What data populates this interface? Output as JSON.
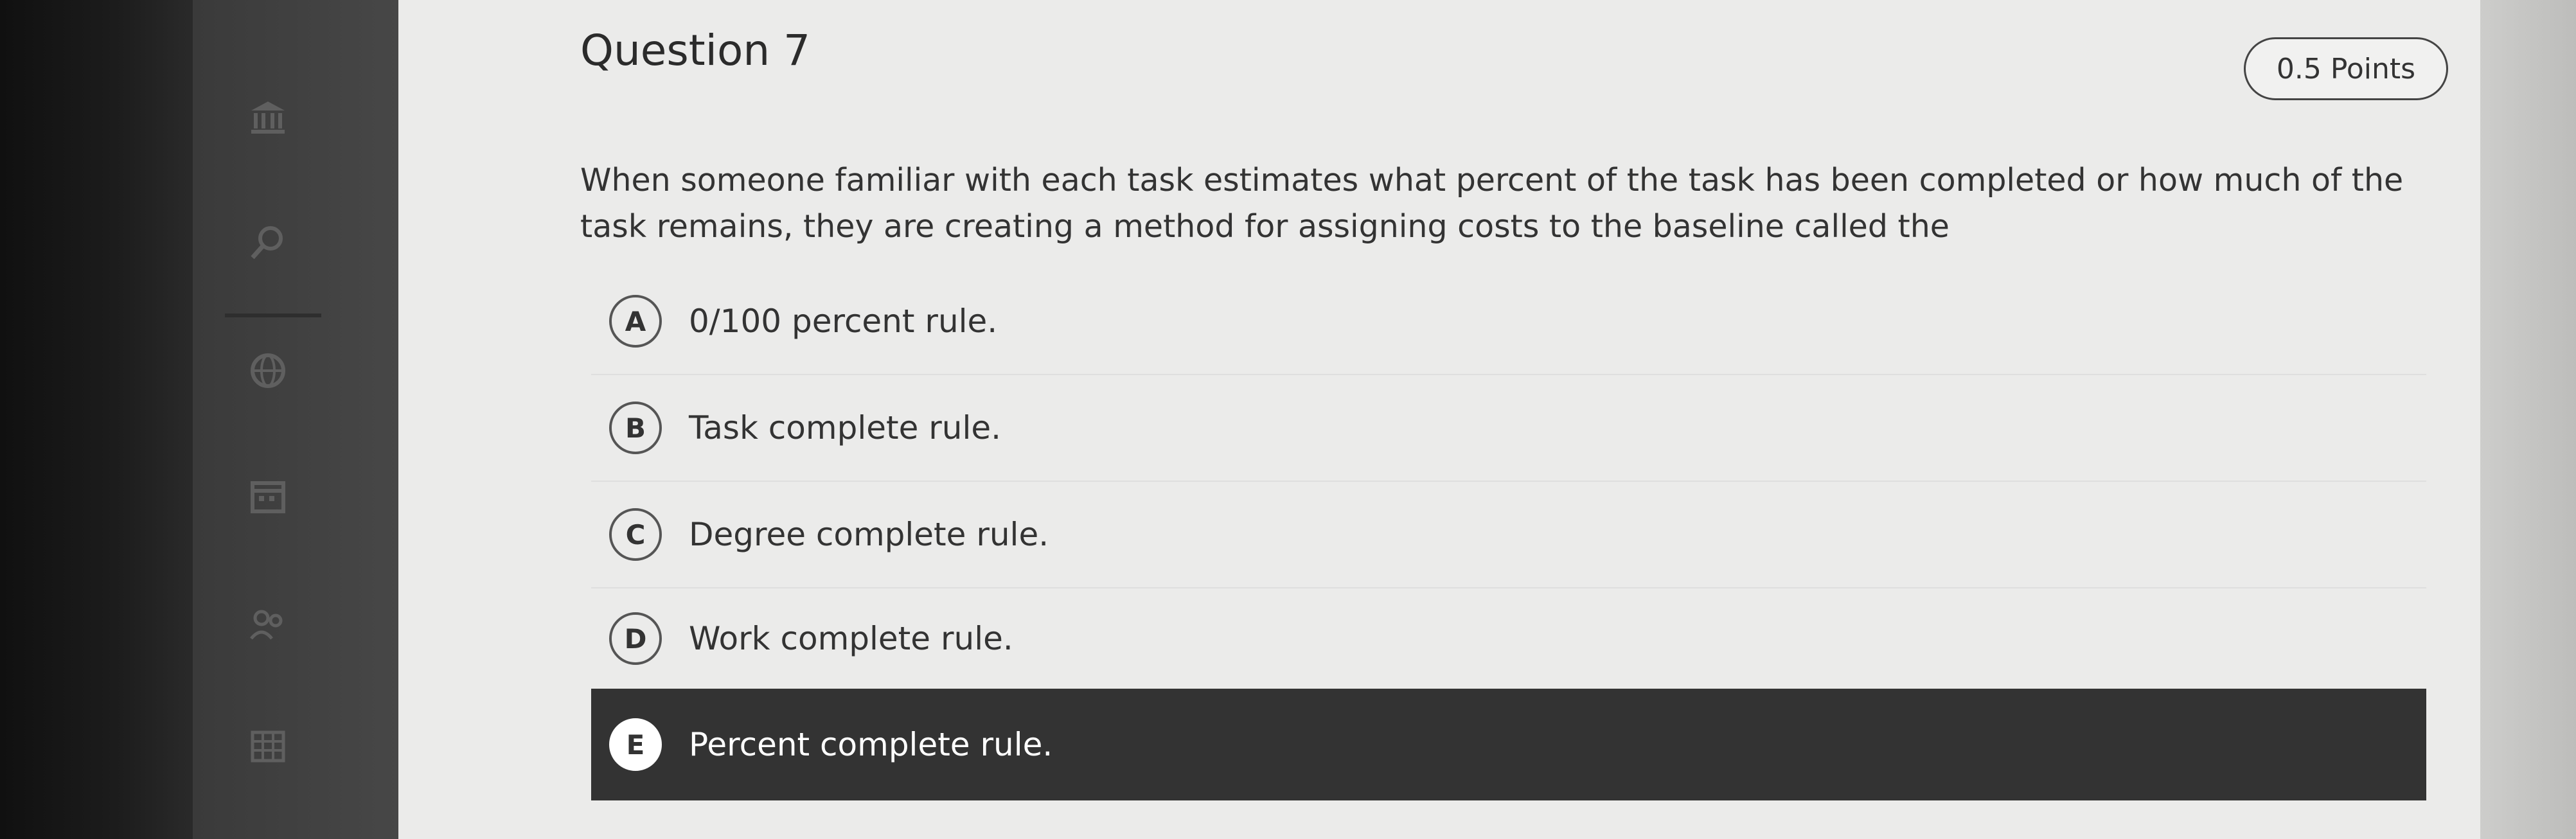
{
  "question": {
    "title": "Question 7",
    "points": "0.5 Points",
    "text": "When someone familiar with each task estimates what percent of the task has been completed or how much of the task remains, they are creating a method for assigning costs to the baseline called the"
  },
  "options": [
    {
      "letter": "A",
      "text": "0/100 percent rule.",
      "selected": false
    },
    {
      "letter": "B",
      "text": "Task complete rule.",
      "selected": false
    },
    {
      "letter": "C",
      "text": "Degree complete rule.",
      "selected": false
    },
    {
      "letter": "D",
      "text": "Work complete rule.",
      "selected": false
    },
    {
      "letter": "E",
      "text": "Percent complete rule.",
      "selected": true
    }
  ],
  "sidebar": {
    "icons": [
      "institution-icon",
      "search-icon",
      "globe-icon",
      "calendar-icon",
      "people-icon",
      "grid-icon"
    ]
  },
  "colors": {
    "selected_background": "#333333",
    "content_background": "#ebebea",
    "sidebar_background": "#444444"
  }
}
